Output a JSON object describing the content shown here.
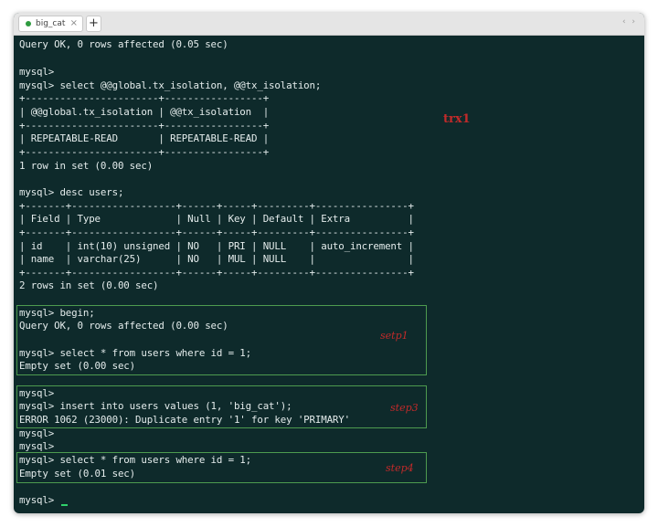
{
  "tab": {
    "title": "big_cat",
    "close": "×",
    "add": "+"
  },
  "window_controls": "‹ ›",
  "lines": [
    "Query OK, 0 rows affected (0.05 sec)",
    "",
    "mysql>",
    "mysql> select @@global.tx_isolation, @@tx_isolation;",
    "+-----------------------+-----------------+",
    "| @@global.tx_isolation | @@tx_isolation  |",
    "+-----------------------+-----------------+",
    "| REPEATABLE-READ       | REPEATABLE-READ |",
    "+-----------------------+-----------------+",
    "1 row in set (0.00 sec)",
    "",
    "mysql> desc users;",
    "+-------+------------------+------+-----+---------+----------------+",
    "| Field | Type             | Null | Key | Default | Extra          |",
    "+-------+------------------+------+-----+---------+----------------+",
    "| id    | int(10) unsigned | NO   | PRI | NULL    | auto_increment |",
    "| name  | varchar(25)      | NO   | MUL | NULL    |                |",
    "+-------+------------------+------+-----+---------+----------------+",
    "2 rows in set (0.00 sec)",
    "",
    "mysql> begin;",
    "Query OK, 0 rows affected (0.00 sec)",
    "",
    "mysql> select * from users where id = 1;",
    "Empty set (0.00 sec)",
    "",
    "mysql>",
    "mysql> insert into users values (1, 'big_cat');",
    "ERROR 1062 (23000): Duplicate entry '1' for key 'PRIMARY'",
    "mysql>",
    "mysql>",
    "mysql> select * from users where id = 1;",
    "Empty set (0.01 sec)",
    "",
    "mysql> "
  ],
  "annotations": {
    "trx": "trx1",
    "step1": "setp1",
    "step3": "step3",
    "step4": "step4"
  },
  "colors": {
    "terminal_bg": "#0e2a2b",
    "text": "#e4ecec",
    "box_border": "#4d9b4f",
    "annotation": "#c12a2a",
    "cursor": "#2fd16b"
  }
}
